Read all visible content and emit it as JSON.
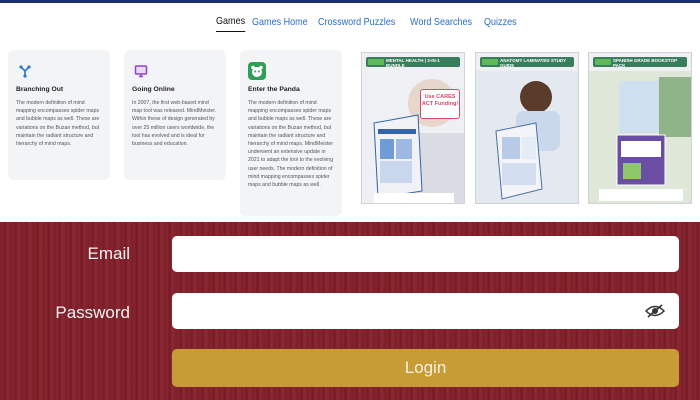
{
  "nav": {
    "items": [
      {
        "label": "Games",
        "active": true
      },
      {
        "label": "Games Home"
      },
      {
        "label": "Crossword Puzzles"
      },
      {
        "label": "Word Searches"
      },
      {
        "label": "Quizzes"
      }
    ]
  },
  "cards": [
    {
      "icon": "branch-icon",
      "color": "#2a78c8",
      "title": "Branching Out",
      "text": "The modern definition of mind mapping encompasses spider maps and bubble maps as well. These are variations on the Buzan method, but maintain the radiant structure and hierarchy of mind maps."
    },
    {
      "icon": "monitor-icon",
      "color": "#8e44c9",
      "title": "Going Online",
      "text": "In 2007, the first web-based mind map tool was released. MindMeister. Within these of design generated by over 25 million users worldwide, the tool has evolved and is ideal for business and education."
    },
    {
      "icon": "panda-icon",
      "color": "#2f9e57",
      "title": "Enter the Panda",
      "text": "The modern definition of mind mapping encompasses spider maps and bubble maps as well. These are variations on the Buzan method, but maintain the radiant structure and hierarchy of mind maps. MindMeister underwent an extensive update in 2021 to adapt the tool to the evolving user needs. The modern definition of mind mapping encompasses spider maps and bubble maps as well."
    }
  ],
  "products": [
    {
      "header": "MENTAL HEALTH | 3-IN-1 BUNDLE",
      "badge": "Use CARES ACT Funding!"
    },
    {
      "header": "ANATOMY LAMINATED STUDY GUIDE"
    },
    {
      "header": "SPANISH GRADE BOOKSTOP PACK"
    }
  ],
  "login": {
    "email_label": "Email",
    "password_label": "Password",
    "email_value": "",
    "password_value": "",
    "button_label": "Login"
  },
  "colors": {
    "maroon": "#7d2029",
    "gold": "#c89c35",
    "link": "#2a6cc4",
    "navy": "#1b2d6b"
  }
}
